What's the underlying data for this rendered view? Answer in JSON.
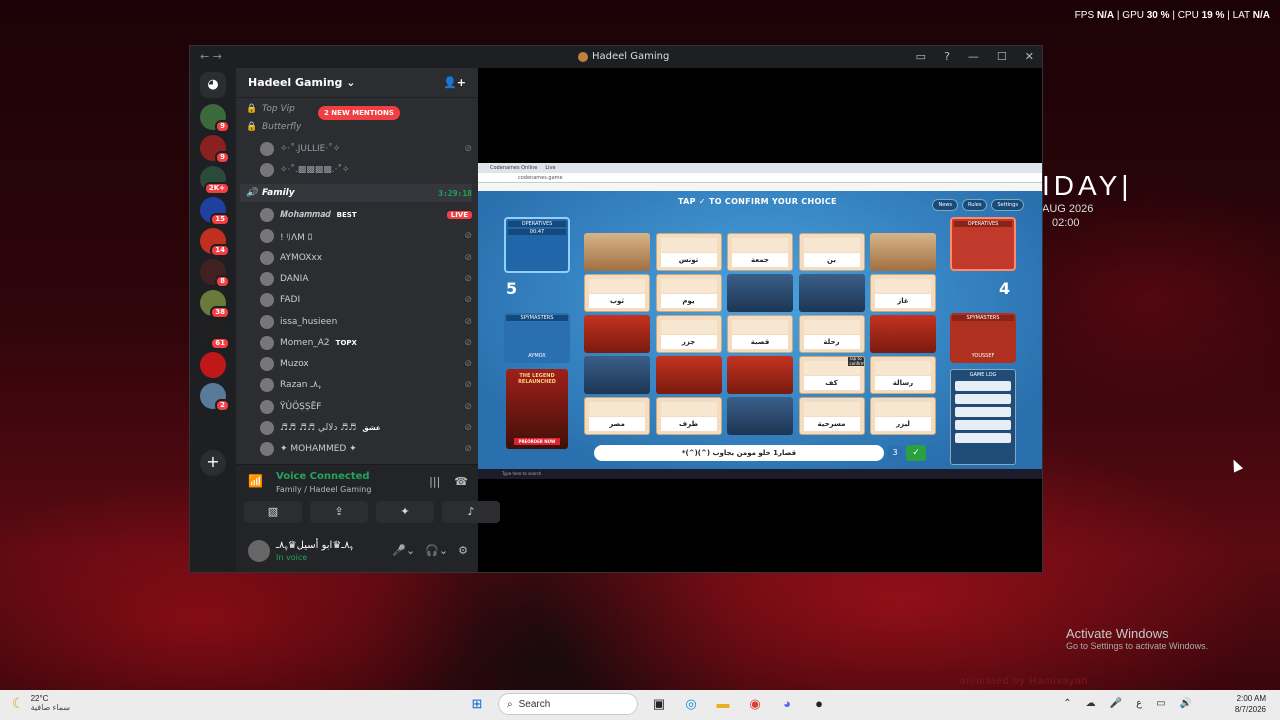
{
  "overlay": {
    "fps_label": "FPS",
    "fps": "N/A",
    "gpu_label": "GPU",
    "gpu": "30 %",
    "cpu_label": "CPU",
    "cpu": "19 %",
    "lat_label": "LAT",
    "lat": "N/A"
  },
  "desktop_clock": {
    "day": "IDAY|",
    "date": "AUG 2026",
    "time": "02:00"
  },
  "activate": {
    "title": "Activate Windows",
    "sub": "Go to Settings to activate Windows."
  },
  "anim_text": "animated by Hamixayah",
  "window": {
    "title": "Hadeel Gaming"
  },
  "servers": [
    {
      "badge": "9",
      "color": "#3a6a3a"
    },
    {
      "badge": "9",
      "color": "#8a2020"
    },
    {
      "badge": "2K+",
      "color": "#2a4a3a"
    },
    {
      "badge": "15",
      "color": "#2040a0"
    },
    {
      "badge": "14",
      "color": "#c03020"
    },
    {
      "badge": "8",
      "color": "#402020"
    },
    {
      "badge": "38",
      "color": "#6a7a3a"
    },
    {
      "badge": "61",
      "color": "#202020"
    },
    {
      "badge": "",
      "color": "#c01818"
    },
    {
      "badge": "2",
      "color": "#5a7a9a"
    }
  ],
  "sidebar": {
    "server_name": "Hadeel Gaming",
    "new_mentions": "2 NEW MENTIONS",
    "channels": [
      {
        "name": "Top Vip"
      },
      {
        "name": "Butterfly"
      }
    ],
    "top_users": [
      "✧·˚.JULLIE·˚✧",
      "✧·˚.▩▩▩▩.·˚✧"
    ],
    "current_channel": "Family",
    "call_time": "3:29:18",
    "members": [
      {
        "name": "𝑴𝒐𝒉𝒂𝒎𝒎𝒂𝒅",
        "tag": "BEST",
        "live": "LIVE"
      },
      {
        "name": "! ﾘΛM ﾛ"
      },
      {
        "name": "AYMOXxx"
      },
      {
        "name": "DANIA"
      },
      {
        "name": "FADI"
      },
      {
        "name": "issa_husieen"
      },
      {
        "name": "Momen_A2",
        "tag": "TOPX"
      },
      {
        "name": "Muzox"
      },
      {
        "name": "Razan ﮩ٨ـ"
      },
      {
        "name": "ŸÙÖṢṢĒF"
      },
      {
        "name": "♬♬ ♬♬ دلالي ♬♬",
        "tag": "عشق"
      },
      {
        "name": "✦ MOHAMMED ✦"
      }
    ],
    "voice": {
      "status": "Voice Connected",
      "channel": "Family / Hadeel Gaming"
    },
    "user": {
      "name": "ﮩ٨ـ♛ابو أسيل♛ﮩ٨ـ",
      "status": "In voice"
    }
  },
  "game": {
    "tap_message": "TAP ✓ TO CONFIRM YOUR CHOICE",
    "nav": [
      "News",
      "Rules",
      "Settings"
    ],
    "left_team_label": "OPERATIVES",
    "left_timer": "00:47",
    "left_score": "5",
    "left_spy_label": "SPYMASTERS",
    "left_spy": "AYMOX",
    "right_team_label": "OPERATIVES",
    "right_score": "4",
    "right_spy_label": "SPYMASTERS",
    "right_spy": "YOUSSEF",
    "legend_title": "THE LEGEND RELAUNCHED",
    "legend_btn": "PREORDER NOW",
    "log_title": "GAME LOG",
    "cards": [
      {
        "t": "tan"
      },
      {
        "t": "word",
        "w": "تونس"
      },
      {
        "t": "word",
        "w": "جمعة"
      },
      {
        "t": "word",
        "w": "بن"
      },
      {
        "t": "tan"
      },
      {
        "t": "word",
        "w": "ثوب"
      },
      {
        "t": "word",
        "w": "يوم"
      },
      {
        "t": "blue"
      },
      {
        "t": "blue"
      },
      {
        "t": "word",
        "w": "غاز"
      },
      {
        "t": "red"
      },
      {
        "t": "word",
        "w": "جزر"
      },
      {
        "t": "word",
        "w": "قصبة"
      },
      {
        "t": "word",
        "w": "رحلة"
      },
      {
        "t": "red"
      },
      {
        "t": "blue"
      },
      {
        "t": "red"
      },
      {
        "t": "red"
      },
      {
        "t": "word",
        "w": "كف",
        "tip": "Tap to confirm"
      },
      {
        "t": "word",
        "w": "رسالة"
      },
      {
        "t": "word",
        "w": "مصر"
      },
      {
        "t": "word",
        "w": "ظرف"
      },
      {
        "t": "blue"
      },
      {
        "t": "word",
        "w": "مسرحية"
      },
      {
        "t": "word",
        "w": "ليزر"
      }
    ],
    "clue": "*(^)(^) قصار1 خلو مومن بجاوب",
    "clue_num": "3"
  },
  "taskbar": {
    "temp": "22°C",
    "weather": "سماء صافية",
    "search": "Search",
    "time": "2:00 AM",
    "date": "8/7/2026",
    "lang": "ع"
  }
}
